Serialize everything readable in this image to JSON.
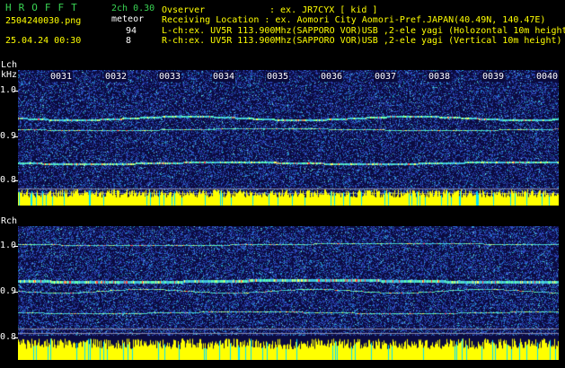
{
  "header": {
    "logo": "HROFFT",
    "config": "2ch 0.30",
    "filename": "2504240030.png",
    "mode": "meteor",
    "datetime": "25.04.24 00:30",
    "count_l": "94",
    "count_r": "8",
    "observer_label": "Ovserver",
    "observer_value": ": ex. JR7CYX [ kid ]",
    "location_line": "Receiving Location : ex. Aomori City Aomori-Pref.JAPAN(40.49N, 140.47E)",
    "lch_line": "L-ch:ex. UV5R 113.900Mhz(SAPPORO VOR)USB ,2-ele yagi (Holozontal 10m height)",
    "rch_line": "R-ch:ex. UV5R 113.900Mhz(SAPPORO VOR)USB ,2-ele yagi (Vertical 10m height)"
  },
  "left_panel": {
    "channel": "Lch",
    "unit": "kHz",
    "yticks": [
      "1.0",
      "0.9",
      "0.8"
    ],
    "time_labels": [
      "0031",
      "0032",
      "0033",
      "0034",
      "0035",
      "0036",
      "0037",
      "0038",
      "0039",
      "0040"
    ]
  },
  "right_panel": {
    "channel": "Rch",
    "yticks": [
      "1.0",
      "0.9",
      "0.8"
    ]
  },
  "colors": {
    "background": "#000000",
    "plot_bg": "#0a0a3a",
    "level_bar": "#ffff00",
    "header_green": "#39d353"
  }
}
